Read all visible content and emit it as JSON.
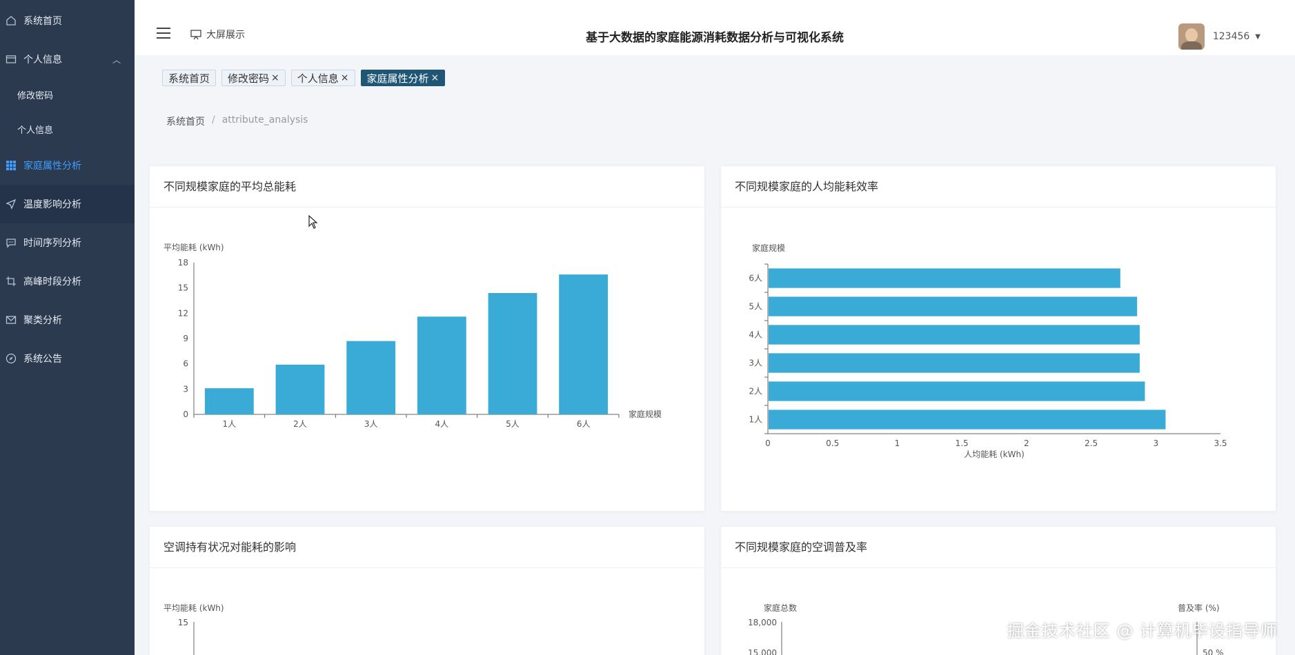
{
  "sidebar": {
    "items": [
      {
        "label": "系统首页",
        "icon": "home-icon"
      },
      {
        "label": "个人信息",
        "icon": "id-card-icon"
      },
      {
        "label": "修改密码"
      },
      {
        "label": "个人信息"
      },
      {
        "label": "家庭属性分析",
        "icon": "grid-icon"
      },
      {
        "label": "温度影响分析",
        "icon": "send-icon"
      },
      {
        "label": "时间序列分析",
        "icon": "chat-icon"
      },
      {
        "label": "高峰时段分析",
        "icon": "crop-icon"
      },
      {
        "label": "聚类分析",
        "icon": "mail-icon"
      },
      {
        "label": "系统公告",
        "icon": "compass-icon"
      }
    ],
    "active_color": "#409eff",
    "background": "#2b3a4f"
  },
  "header": {
    "screen_label": "大屏展示",
    "title": "基于大数据的家庭能源消耗数据分析与可视化系统",
    "username": "123456"
  },
  "tags": [
    {
      "label": "系统首页"
    },
    {
      "label": "修改密码",
      "close": "×"
    },
    {
      "label": "个人信息",
      "close": "×"
    },
    {
      "label": "家庭属性分析",
      "close": "×"
    }
  ],
  "breadcrumb": {
    "home": "系统首页",
    "sep": "/",
    "current": "attribute_analysis"
  },
  "cards": {
    "c1_title": "不同规模家庭的平均总能耗",
    "c2_title": "不同规模家庭的人均能耗效率",
    "c3_title": "空调持有状况对能耗的影响",
    "c4_title": "不同规模家庭的空调普及率"
  },
  "chart_data": [
    {
      "type": "bar",
      "title": "不同规模家庭的平均总能耗",
      "ylabel": "平均能耗 (kWh)",
      "xlabel": "家庭规模",
      "categories": [
        "1人",
        "2人",
        "3人",
        "4人",
        "5人",
        "6人"
      ],
      "values": [
        3.1,
        5.9,
        8.7,
        11.6,
        14.4,
        16.6
      ],
      "ylim": [
        0,
        18
      ],
      "yticks": [
        0,
        3,
        6,
        9,
        12,
        15,
        18
      ],
      "color": "#3aabd6"
    },
    {
      "type": "bar",
      "orientation": "horizontal",
      "title": "不同规模家庭的人均能耗效率",
      "ylabel": "家庭规模",
      "xlabel": "人均能耗 (kWh)",
      "categories": [
        "1人",
        "2人",
        "3人",
        "4人",
        "5人",
        "6人"
      ],
      "values": [
        3.07,
        2.91,
        2.87,
        2.87,
        2.85,
        2.72
      ],
      "xlim": [
        0,
        3.5
      ],
      "xticks": [
        "0",
        "0.5",
        "1",
        "1.5",
        "2",
        "2.5",
        "3",
        "3.5"
      ],
      "color": "#3aabd6"
    },
    {
      "type": "bar",
      "title": "空调持有状况对能耗的影响",
      "ylabel": "平均能耗 (kWh)",
      "yticks": [
        "15"
      ]
    },
    {
      "type": "bar",
      "title": "不同规模家庭的空调普及率",
      "ylabel": "家庭总数",
      "y2label": "普及率 (%)",
      "yticks": [
        "18,000",
        "15,000"
      ],
      "y2ticks": [
        "50 %"
      ]
    }
  ],
  "watermark": "掘金技术社区 @ 计算机毕设指导师"
}
